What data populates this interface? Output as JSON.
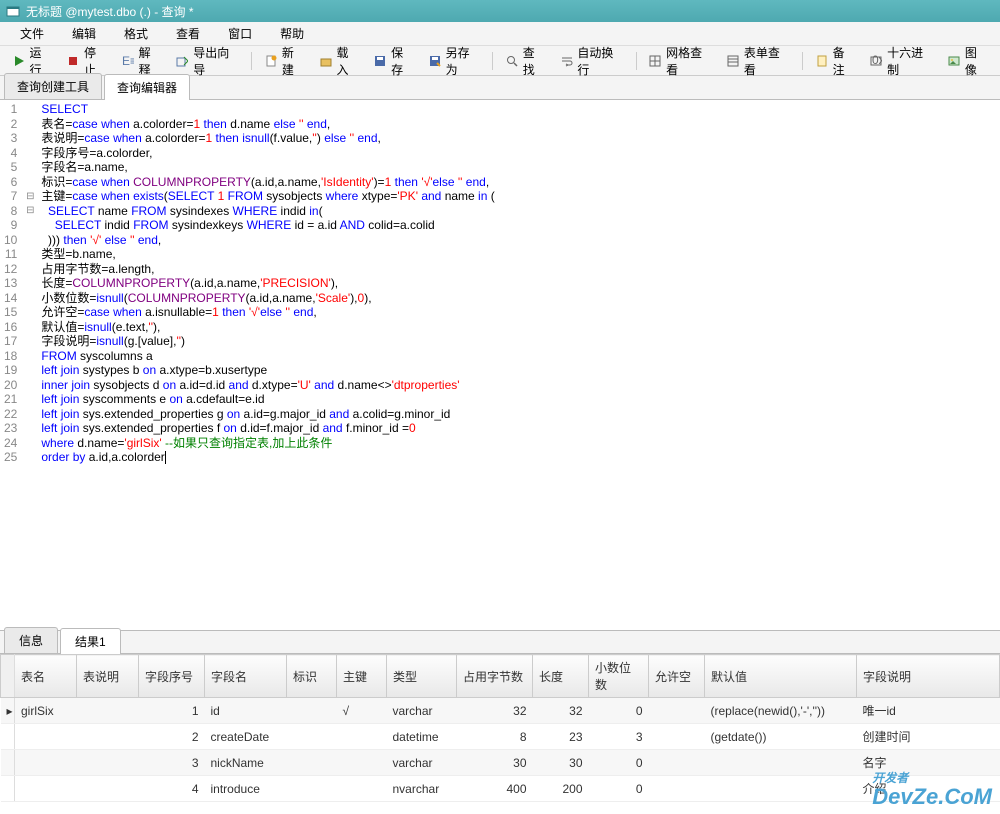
{
  "title": "无标题 @mytest.dbo (.) - 查询 *",
  "menu": [
    "文件",
    "编辑",
    "格式",
    "查看",
    "窗口",
    "帮助"
  ],
  "toolbar": {
    "run": "运行",
    "stop": "停止",
    "explain": "解释",
    "export_wizard": "导出向导",
    "new": "新建",
    "load": "载入",
    "save": "保存",
    "save_as": "另存为",
    "find": "查找",
    "wrap": "自动换行",
    "grid_view": "网格查看",
    "form_view": "表单查看",
    "notes": "备注",
    "hex": "十六进制",
    "image": "图像"
  },
  "tabs": {
    "builder": "查询创建工具",
    "editor": "查询编辑器"
  },
  "code_lines": [
    "SELECT",
    "表名=case when a.colorder=1 then d.name else '' end,",
    "表说明=case when a.colorder=1 then isnull(f.value,'') else '' end,",
    "字段序号=a.colorder,",
    "字段名=a.name,",
    "标识=case when COLUMNPROPERTY(a.id,a.name,'IsIdentity')=1 then '√'else '' end,",
    "主键=case when exists(SELECT 1 FROM sysobjects where xtype='PK' and name in (",
    "  SELECT name FROM sysindexes WHERE indid in(",
    "    SELECT indid FROM sysindexkeys WHERE id = a.id AND colid=a.colid",
    "  ))) then '√' else '' end,",
    "类型=b.name,",
    "占用字节数=a.length,",
    "长度=COLUMNPROPERTY(a.id,a.name,'PRECISION'),",
    "小数位数=isnull(COLUMNPROPERTY(a.id,a.name,'Scale'),0),",
    "允许空=case when a.isnullable=1 then '√'else '' end,",
    "默认值=isnull(e.text,''),",
    "字段说明=isnull(g.[value],'')",
    "FROM syscolumns a",
    "left join systypes b on a.xtype=b.xusertype",
    "inner join sysobjects d on a.id=d.id and d.xtype='U' and d.name<>'dtproperties'",
    "left join syscomments e on a.cdefault=e.id",
    "left join sys.extended_properties g on a.id=g.major_id and a.colid=g.minor_id",
    "left join sys.extended_properties f on d.id=f.major_id and f.minor_id =0",
    "where d.name='girlSix' --如果只查询指定表,加上此条件",
    "order by a.id,a.colorder"
  ],
  "bottom_tabs": {
    "messages": "信息",
    "result1": "结果1"
  },
  "columns": [
    "表名",
    "表说明",
    "字段序号",
    "字段名",
    "标识",
    "主键",
    "类型",
    "占用字节数",
    "长度",
    "小数位数",
    "允许空",
    "默认值",
    "字段说明"
  ],
  "rows": [
    {
      "table": "girlSix",
      "tdesc": "",
      "ord": "1",
      "field": "id",
      "ident": "",
      "pk": "√",
      "type": "varchar",
      "bytes": "32",
      "len": "32",
      "scale": "0",
      "null": "",
      "def": "(replace(newid(),'-',''))",
      "fdesc": "唯一id"
    },
    {
      "table": "",
      "tdesc": "",
      "ord": "2",
      "field": "createDate",
      "ident": "",
      "pk": "",
      "type": "datetime",
      "bytes": "8",
      "len": "23",
      "scale": "3",
      "null": "",
      "def": "(getdate())",
      "fdesc": "创建时间"
    },
    {
      "table": "",
      "tdesc": "",
      "ord": "3",
      "field": "nickName",
      "ident": "",
      "pk": "",
      "type": "varchar",
      "bytes": "30",
      "len": "30",
      "scale": "0",
      "null": "",
      "def": "",
      "fdesc": "名字"
    },
    {
      "table": "",
      "tdesc": "",
      "ord": "4",
      "field": "introduce",
      "ident": "",
      "pk": "",
      "type": "nvarchar",
      "bytes": "400",
      "len": "200",
      "scale": "0",
      "null": "",
      "def": "",
      "fdesc": "介绍"
    }
  ],
  "watermark": {
    "l1": "开发者",
    "l2": "DevZe.CoM"
  }
}
